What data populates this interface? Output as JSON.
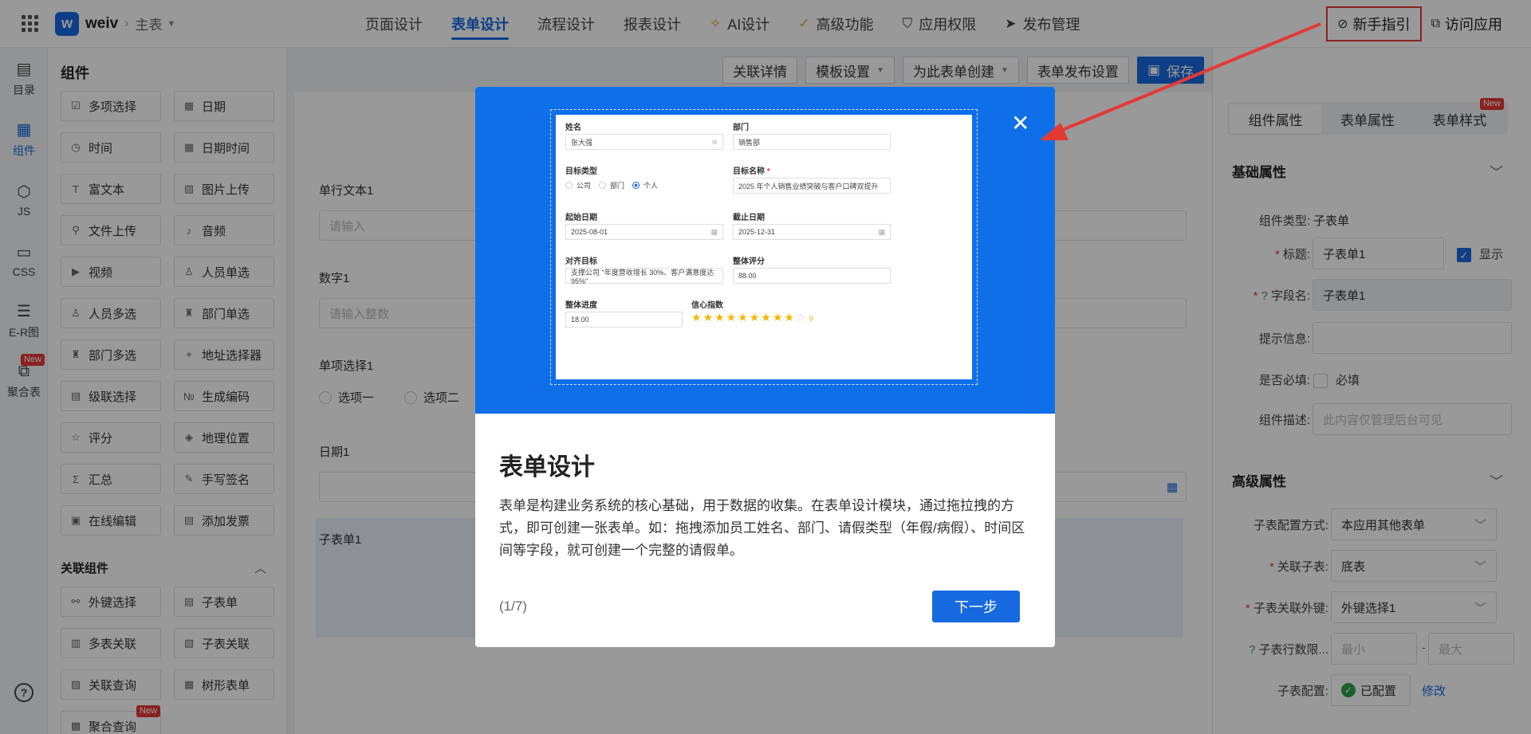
{
  "header": {
    "app_name": "weiv",
    "logo_text": "w",
    "breadcrumb": "主表",
    "nav": [
      {
        "label": "页面设计",
        "icon": ""
      },
      {
        "label": "表单设计",
        "icon": ""
      },
      {
        "label": "流程设计",
        "icon": ""
      },
      {
        "label": "报表设计",
        "icon": ""
      },
      {
        "label": "AI设计",
        "icon": "ai-spark-icon"
      },
      {
        "label": "高级功能",
        "icon": "magic-icon"
      },
      {
        "label": "应用权限",
        "icon": "shield-icon"
      },
      {
        "label": "发布管理",
        "icon": "send-icon"
      }
    ],
    "active_nav": "表单设计",
    "guide_label": "新手指引",
    "visit_label": "访问应用"
  },
  "leftnav": {
    "items": [
      {
        "label": "目录",
        "icon": "catalog-icon"
      },
      {
        "label": "组件",
        "icon": "components-icon"
      },
      {
        "label": "JS",
        "icon": "js-icon"
      },
      {
        "label": "CSS",
        "icon": "css-icon"
      },
      {
        "label": "E-R图",
        "icon": "er-diagram-icon"
      },
      {
        "label": "聚合表",
        "icon": "aggregate-table-icon"
      }
    ],
    "badge": "New"
  },
  "components": {
    "title": "组件",
    "basic": [
      "多项选择",
      "日期",
      "时间",
      "日期时间",
      "富文本",
      "图片上传",
      "文件上传",
      "音频",
      "视频",
      "人员单选",
      "人员多选",
      "部门单选",
      "部门多选",
      "地址选择器",
      "级联选择",
      "生成编码",
      "评分",
      "地理位置",
      "汇总",
      "手写签名",
      "在线编辑",
      "添加发票"
    ],
    "related_title": "关联组件",
    "related": [
      "外键选择",
      "子表单",
      "多表关联",
      "子表关联",
      "关联查询",
      "树形表单",
      "聚合查询"
    ],
    "badge": "New"
  },
  "toolbar": {
    "buttons": [
      "关联详情",
      "模板设置",
      "为此表单创建",
      "表单发布设置"
    ],
    "save_label": "保存"
  },
  "canvas": {
    "text_label": "单行文本1",
    "text_placeholder": "请输入",
    "number_label": "数字1",
    "number_placeholder": "请输入整数",
    "radio_label": "单项选择1",
    "radio_options": [
      "选项一",
      "选项二"
    ],
    "date_label": "日期1",
    "subform_label": "子表单1"
  },
  "props": {
    "tabs": [
      "组件属性",
      "表单属性",
      "表单样式"
    ],
    "tab_badge": "New",
    "basic_title": "基础属性",
    "comp_type_label": "组件类型:",
    "comp_type_value": "子表单",
    "title_label": "标题:",
    "title_value": "子表单1",
    "show_label": "显示",
    "field_label": "字段名:",
    "field_value": "子表单1",
    "hint_label": "提示信息:",
    "required_label": "是否必填:",
    "required_text": "必填",
    "desc_label": "组件描述:",
    "desc_placeholder": "此内容仅管理后台可见",
    "adv_title": "高级属性",
    "config_mode_label": "子表配置方式:",
    "config_mode_value": "本应用其他表单",
    "sub_table_label": "关联子表:",
    "sub_table_value": "底表",
    "fk_label": "子表关联外键:",
    "fk_value": "外键选择1",
    "rows_label": "子表行数限...",
    "rows_min": "最小",
    "rows_max": "最大",
    "sub_config_label": "子表配置:",
    "sub_config_value": "已配置",
    "edit_label": "修改"
  },
  "modal": {
    "preview": {
      "name_label": "姓名",
      "name_value": "张大强",
      "dept_label": "部门",
      "dept_value": "销售部",
      "type_label": "目标类型",
      "type_options": [
        "公司",
        "部门",
        "个人"
      ],
      "goal_label": "目标名称",
      "goal_value": "2025 年个人销售业绩突破与客户口碑双提升",
      "start_label": "起始日期",
      "start_value": "2025-08-01",
      "end_label": "截止日期",
      "end_value": "2025-12-31",
      "align_label": "对齐目标",
      "align_value": "支撑公司 \"年度营收增长 30%、客户满意度达 95%\"",
      "score_label": "整体评分",
      "score_value": "88.00",
      "progress_label": "整体进度",
      "progress_value": "18.00",
      "confidence_label": "信心指数",
      "confidence_stars": "★★★★★★★★★",
      "confidence_empty": "☆",
      "confidence_num": "9",
      "confidence_rating": 9
    },
    "title": "表单设计",
    "description": "表单是构建业务系统的核心基础，用于数据的收集。在表单设计模块，通过拖拉拽的方式，即可创建一张表单。如：拖拽添加员工姓名、部门、请假类型（年假/病假）、时间区间等字段，就可创建一个完整的请假单。",
    "step": "(1/7)",
    "next_label": "下一步"
  },
  "colors": {
    "accent": "#1769e0",
    "hero": "#0f6fe8",
    "highlight": "#e53935"
  }
}
